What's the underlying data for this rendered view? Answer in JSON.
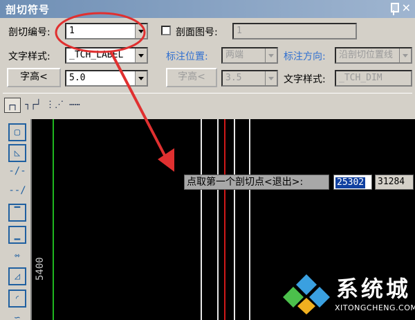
{
  "dialog": {
    "title": "剖切符号",
    "row1": {
      "section_no_label": "剖切编号:",
      "section_no_value": "1",
      "section_view_label": "剖面图号:",
      "section_view_value": "1",
      "section_view_checked": false
    },
    "row2": {
      "text_style_label": "文字样式:",
      "text_style_value": "_TCH_LABEL",
      "label_pos_label": "标注位置:",
      "label_pos_value": "两端",
      "label_dir_label": "标注方向:",
      "label_dir_value": "沿剖切位置线"
    },
    "row3": {
      "text_height_button": "字高<",
      "text_height_value": "5.0",
      "text_height_button2": "字高<",
      "text_height_value2": "3.5",
      "text_style2_label": "文字样式:",
      "text_style2_value": "_TCH_DIM"
    },
    "tools": [
      "┌┐",
      "┐┌┘",
      "⋮⋰",
      "⋯⋯"
    ]
  },
  "sidebar": {
    "icons": [
      "rect-select-icon",
      "area-icon",
      "dim-left-icon",
      "dim-right-icon",
      "dim-top-icon",
      "dim-bottom-icon",
      "dim-both-icon",
      "angle-icon",
      "arc-icon",
      "extra-icon"
    ]
  },
  "canvas": {
    "side_number": "5400",
    "prompt": "点取第一个剖切点<退出>:",
    "coord_x": "25302",
    "coord_y": "31284",
    "colors": {
      "green_line": "#1fb81f",
      "red_line": "#d01818",
      "white_line": "#e8e8e8",
      "annotation": "#e03030"
    }
  },
  "watermark": {
    "name": "系统城",
    "url": "XITONGCHENG.COM"
  }
}
